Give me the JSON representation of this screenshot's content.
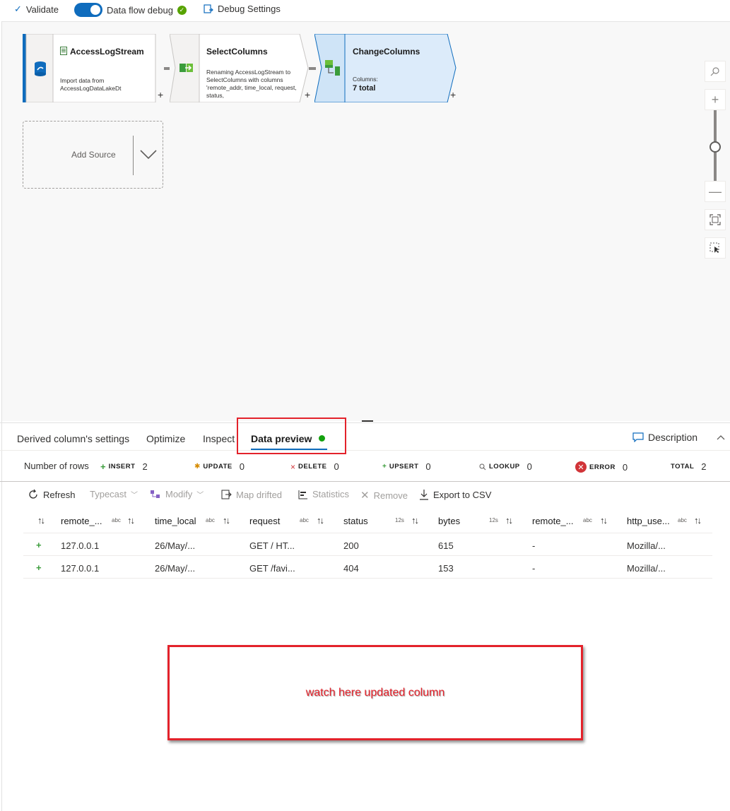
{
  "toolbar": {
    "validate_label": "Validate",
    "debug_label": "Data flow debug",
    "debug_settings_label": "Debug Settings"
  },
  "nodes": [
    {
      "title": "AccessLogStream",
      "description": "Import data from AccessLogDataLakeDt"
    },
    {
      "title": "SelectColumns",
      "description": "Renaming AccessLogStream to SelectColumns with columns 'remote_addr, time_local, request, status,"
    },
    {
      "title": "ChangeColumns",
      "description": "Columns:",
      "count": "7 total"
    }
  ],
  "add_source": {
    "label": "Add Source"
  },
  "tabs": [
    {
      "label": "Derived column's settings"
    },
    {
      "label": "Optimize"
    },
    {
      "label": "Inspect"
    },
    {
      "label": "Data preview",
      "active": true
    }
  ],
  "description_label": "Description",
  "row_stats": {
    "label": "Number of rows",
    "insert": {
      "key": "INSERT",
      "value": "2"
    },
    "update": {
      "key": "UPDATE",
      "value": "0"
    },
    "delete": {
      "key": "DELETE",
      "value": "0"
    },
    "upsert": {
      "key": "UPSERT",
      "value": "0"
    },
    "lookup": {
      "key": "LOOKUP",
      "value": "0"
    },
    "error": {
      "key": "ERROR",
      "value": "0"
    },
    "total": {
      "key": "TOTAL",
      "value": "2"
    }
  },
  "actions": {
    "refresh": "Refresh",
    "typecast": "Typecast",
    "modify": "Modify",
    "map_drifted": "Map drifted",
    "statistics": "Statistics",
    "remove": "Remove",
    "export": "Export to CSV"
  },
  "table": {
    "columns": [
      {
        "name": "remote_...",
        "type": "abc"
      },
      {
        "name": "time_local",
        "type": "abc"
      },
      {
        "name": "request",
        "type": "abc"
      },
      {
        "name": "status",
        "type": "12s"
      },
      {
        "name": "bytes",
        "type": "12s"
      },
      {
        "name": "remote_...",
        "type": "abc"
      },
      {
        "name": "http_use...",
        "type": "abc"
      }
    ],
    "rows": [
      [
        "127.0.0.1",
        "26/May/...",
        "GET / HT...",
        "200",
        "615",
        "-",
        "Mozilla/..."
      ],
      [
        "127.0.0.1",
        "26/May/...",
        "GET /favi...",
        "404",
        "153",
        "-",
        "Mozilla/..."
      ]
    ]
  },
  "annotation": {
    "text": "watch here updated column"
  },
  "colors": {
    "accent": "#0f6cbd",
    "annotation_red": "#e3222b",
    "insert_green": "#3b9c3b"
  }
}
